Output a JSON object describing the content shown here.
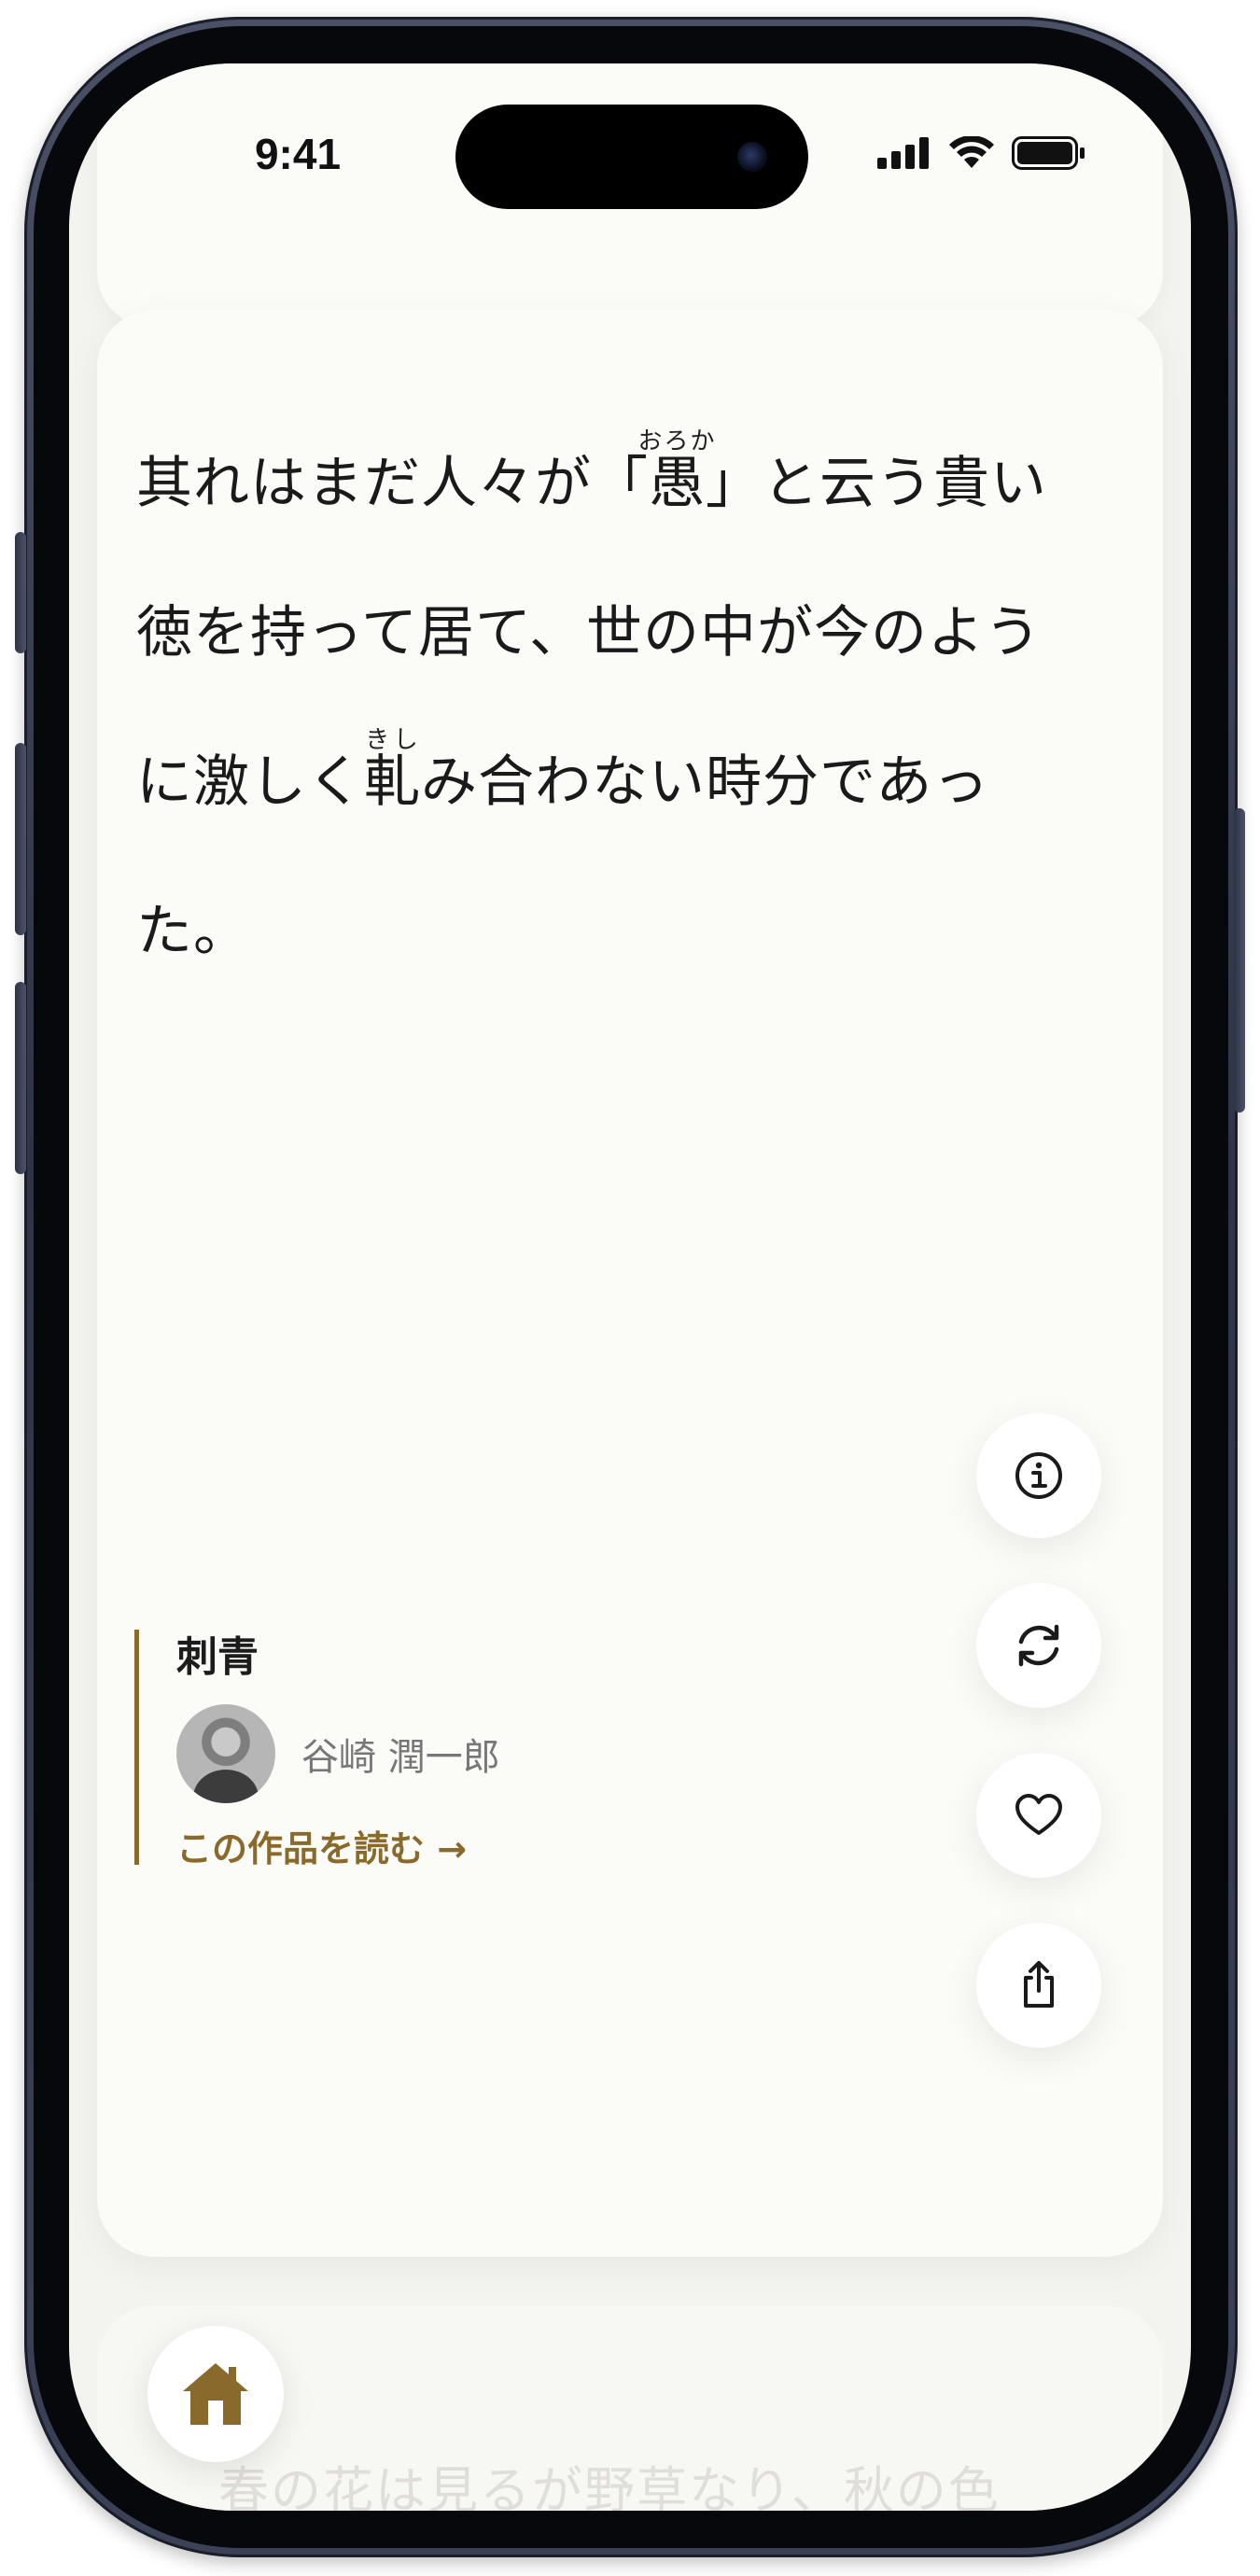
{
  "status_bar": {
    "time": "9:41",
    "signal_icon": "cellular-signal-icon",
    "wifi_icon": "wifi-icon",
    "battery_icon": "battery-icon"
  },
  "quote": {
    "segment_1": "其れはまだ人々が「",
    "ruby_base_1": "愚",
    "ruby_text_1": "おろか",
    "segment_2": "」と云う貴い徳を持って居て、世の中が今のように激しく",
    "ruby_base_2": "軋",
    "ruby_text_2": "きし",
    "segment_3": "み合わない時分であった。"
  },
  "attribution": {
    "work_title": "刺青",
    "author_name": "谷崎 潤一郎",
    "read_link": "この作品を読む →"
  },
  "actions": [
    {
      "name": "info-button",
      "icon": "info-icon"
    },
    {
      "name": "refresh-button",
      "icon": "refresh-icon"
    },
    {
      "name": "favorite-button",
      "icon": "heart-icon"
    },
    {
      "name": "share-button",
      "icon": "share-icon"
    }
  ],
  "next_card": {
    "preview_text": "春の花は見るが野草なり、秋の色"
  },
  "home": {
    "icon": "home-icon"
  },
  "colors": {
    "accent": "#8a6a2c",
    "card_background": "#fbfbf8",
    "screen_background": "#f3f3ef",
    "text_primary": "#1a1a1a",
    "text_secondary": "#777777"
  }
}
